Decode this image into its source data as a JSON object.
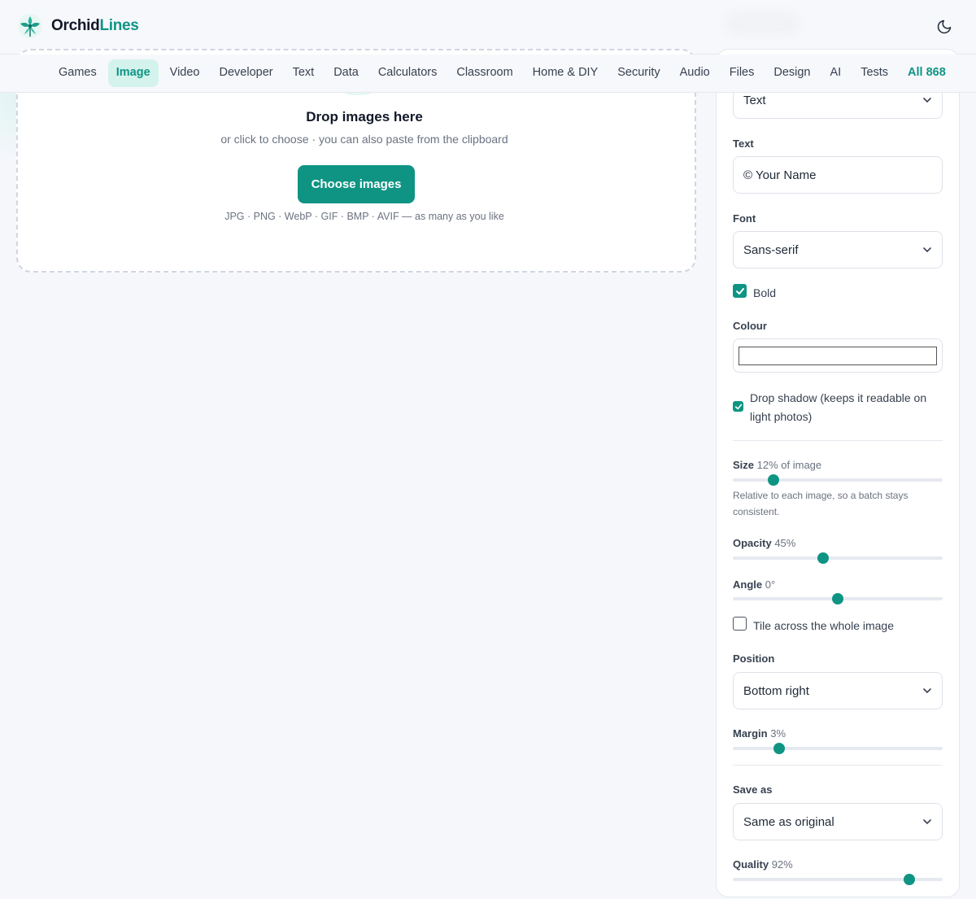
{
  "header": {
    "brand_part1": "Orchid",
    "brand_part2": "Lines"
  },
  "nav": {
    "items": [
      "Games",
      "Image",
      "Video",
      "Developer",
      "Text",
      "Data",
      "Calculators",
      "Classroom",
      "Home & DIY",
      "Security",
      "Audio",
      "Files",
      "Design",
      "AI",
      "Tests"
    ],
    "active": "Image",
    "all_label": "All 868"
  },
  "dropzone": {
    "title": "Drop images here",
    "subtitle": "or click to choose · you can also paste from the clipboard",
    "button_label": "Choose images",
    "formats_hint": "JPG · PNG · WebP · GIF · BMP · AVIF — as many as you like"
  },
  "settings": {
    "type_select": "Text",
    "text_label": "Text",
    "text_value": "© Your Name",
    "font_label": "Font",
    "font_select": "Sans-serif",
    "bold_label": "Bold",
    "bold_checked": true,
    "colour_label": "Colour",
    "colour_value": "#ffffff",
    "shadow_label": "Drop shadow (keeps it readable on light photos)",
    "shadow_checked": true,
    "size_label": "Size",
    "size_value": "12% of image",
    "size_level": 0.195,
    "size_help": "Relative to each image, so a batch stays consistent.",
    "opacity_label": "Opacity",
    "opacity_value": "45%",
    "opacity_level": 0.43,
    "angle_label": "Angle",
    "angle_value": "0°",
    "angle_level": 0.5,
    "tile_label": "Tile across the whole image",
    "tile_checked": false,
    "position_label": "Position",
    "position_select": "Bottom right",
    "margin_label": "Margin",
    "margin_value": "3%",
    "margin_level": 0.222,
    "saveas_label": "Save as",
    "saveas_select": "Same as original",
    "quality_label": "Quality",
    "quality_value": "92%",
    "quality_level": 0.843,
    "accent_color": "#0f9484"
  }
}
